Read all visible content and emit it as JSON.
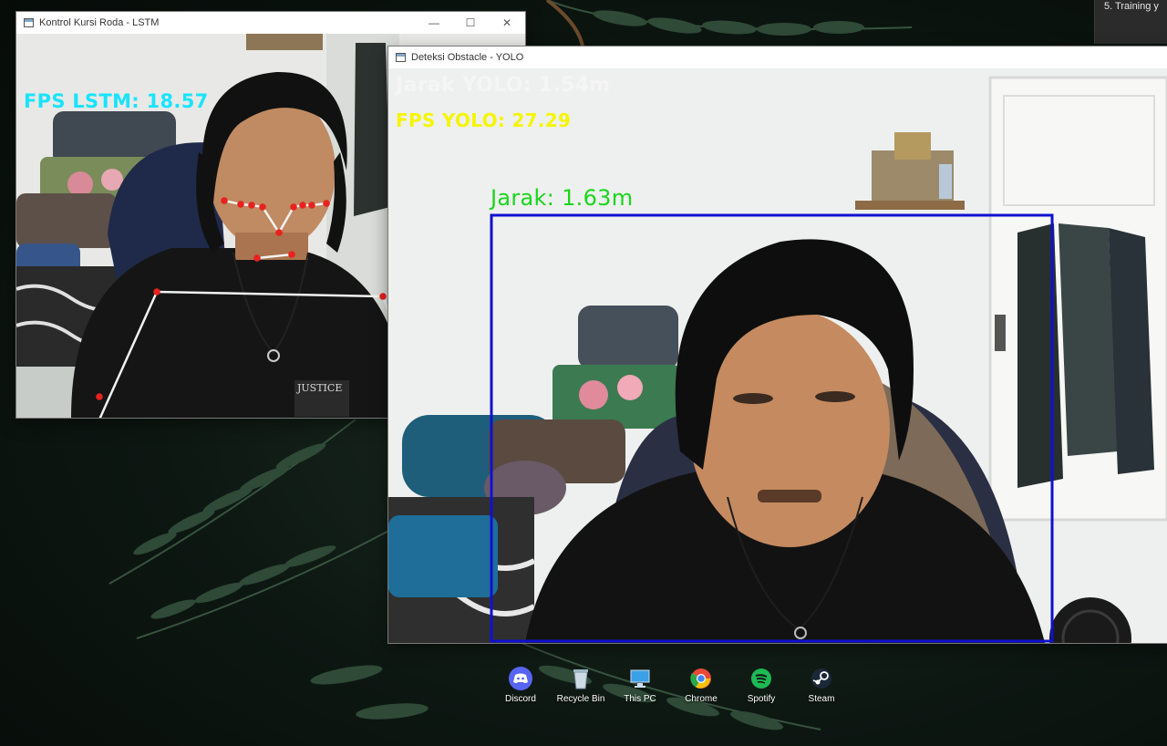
{
  "desktop": {
    "peek_window_text": "5. Training y",
    "icons": [
      {
        "label": "Discord",
        "icon": "discord-icon",
        "color": "#5865F2"
      },
      {
        "label": "Recycle Bin",
        "icon": "recycle-bin-icon",
        "color": "#9fb8c8"
      },
      {
        "label": "This PC",
        "icon": "this-pc-icon",
        "color": "#3aa0e8"
      },
      {
        "label": "Chrome",
        "icon": "chrome-icon",
        "color": "#e84a3a"
      },
      {
        "label": "Spotify",
        "icon": "spotify-icon",
        "color": "#1DB954"
      },
      {
        "label": "Steam",
        "icon": "steam-icon",
        "color": "#1b2838"
      }
    ]
  },
  "lstm_window": {
    "title": "Kontrol Kursi Roda - LSTM",
    "fps_text": "FPS LSTM: 18.57",
    "fps_color": "#19e3ff"
  },
  "yolo_window": {
    "title": "Deteksi Obstacle - YOLO",
    "faded_text": "Jarak YOLO: 1.54m",
    "fps_text": "FPS YOLO: 27.29",
    "fps_color": "#f5f500",
    "detection_label": "Jarak: 1.63m",
    "detection_label_color": "#19d61c",
    "box_color": "#1010d0"
  },
  "window_controls": {
    "minimize": "—",
    "maximize": "☐",
    "close": "✕"
  }
}
